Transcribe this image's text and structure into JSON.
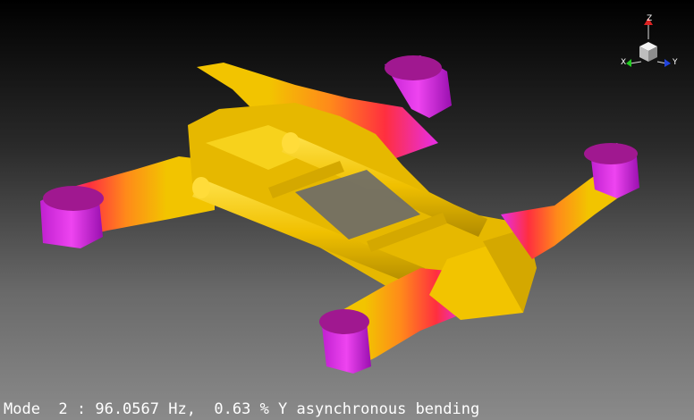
{
  "status_line": "Mode  2 : 96.0567 Hz,  0.63 % Y asynchronous bending",
  "axes": {
    "z": "Z",
    "x": "X",
    "y": "Y"
  },
  "colors": {
    "frame_yellow": "#f2c400",
    "frame_yellow_dark": "#c89c00",
    "mode_red": "#ff2a2a",
    "mode_magenta": "#dd20e0",
    "axis_x": "#22cc22",
    "axis_y": "#2244dd",
    "axis_z": "#dd2222"
  }
}
